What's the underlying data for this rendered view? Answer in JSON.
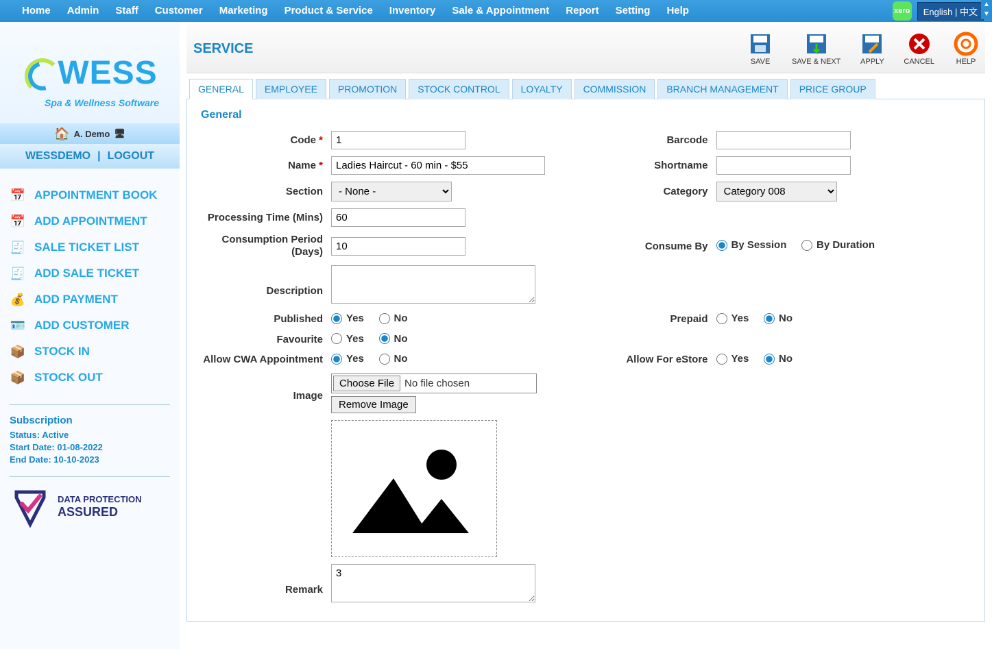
{
  "top_nav": [
    "Home",
    "Admin",
    "Staff",
    "Customer",
    "Marketing",
    "Product & Service",
    "Inventory",
    "Sale & Appointment",
    "Report",
    "Setting",
    "Help"
  ],
  "lang_label": "English | 中文",
  "xero_label": "xero",
  "brand": {
    "name": "WESS",
    "tagline": "Spa & Wellness Software"
  },
  "user": "A. Demo",
  "auth": {
    "site": "WESSDEMO",
    "logout": "LOGOUT"
  },
  "quick_links": [
    {
      "label": "APPOINTMENT BOOK",
      "icon": "📅"
    },
    {
      "label": "ADD APPOINTMENT",
      "icon": "📅"
    },
    {
      "label": "SALE TICKET LIST",
      "icon": "🧾"
    },
    {
      "label": "ADD SALE TICKET",
      "icon": "🧾"
    },
    {
      "label": "ADD PAYMENT",
      "icon": "💰"
    },
    {
      "label": "ADD CUSTOMER",
      "icon": "🪪"
    },
    {
      "label": "STOCK IN",
      "icon": "📦"
    },
    {
      "label": "STOCK OUT",
      "icon": "📦"
    }
  ],
  "subscription": {
    "title": "Subscription",
    "status": "Status: Active",
    "start": "Start Date: 01-08-2022",
    "end": "End Date: 10-10-2023"
  },
  "dp_badge": {
    "line1": "DATA PROTECTION",
    "line2": "ASSURED"
  },
  "page_title": "SERVICE",
  "toolbar": {
    "save": "SAVE",
    "save_next": "SAVE & NEXT",
    "apply": "APPLY",
    "cancel": "CANCEL",
    "help": "HELP"
  },
  "tabs": [
    "GENERAL",
    "EMPLOYEE",
    "PROMOTION",
    "STOCK CONTROL",
    "LOYALTY",
    "COMMISSION",
    "BRANCH MANAGEMENT",
    "PRICE GROUP"
  ],
  "active_tab": "GENERAL",
  "fieldset_title": "General",
  "form": {
    "code_label": "Code",
    "code_value": "1",
    "barcode_label": "Barcode",
    "barcode_value": "",
    "name_label": "Name",
    "name_value": "Ladies Haircut - 60 min - $55",
    "shortname_label": "Shortname",
    "shortname_value": "",
    "section_label": "Section",
    "section_value": "- None -",
    "category_label": "Category",
    "category_value": "Category 008",
    "processing_label": "Processing Time (Mins)",
    "processing_value": "60",
    "consumption_label": "Consumption Period (Days)",
    "consumption_value": "10",
    "consumeby_label": "Consume By",
    "consumeby_opt1": "By Session",
    "consumeby_opt2": "By Duration",
    "description_label": "Description",
    "description_value": "",
    "published_label": "Published",
    "prepaid_label": "Prepaid",
    "favourite_label": "Favourite",
    "allow_cwa_label": "Allow CWA Appointment",
    "allow_estore_label": "Allow For eStore",
    "yes": "Yes",
    "no": "No",
    "image_label": "Image",
    "choose_file": "Choose File",
    "no_file": "No file chosen",
    "remove_image": "Remove Image",
    "remark_label": "Remark",
    "remark_value": "3"
  }
}
